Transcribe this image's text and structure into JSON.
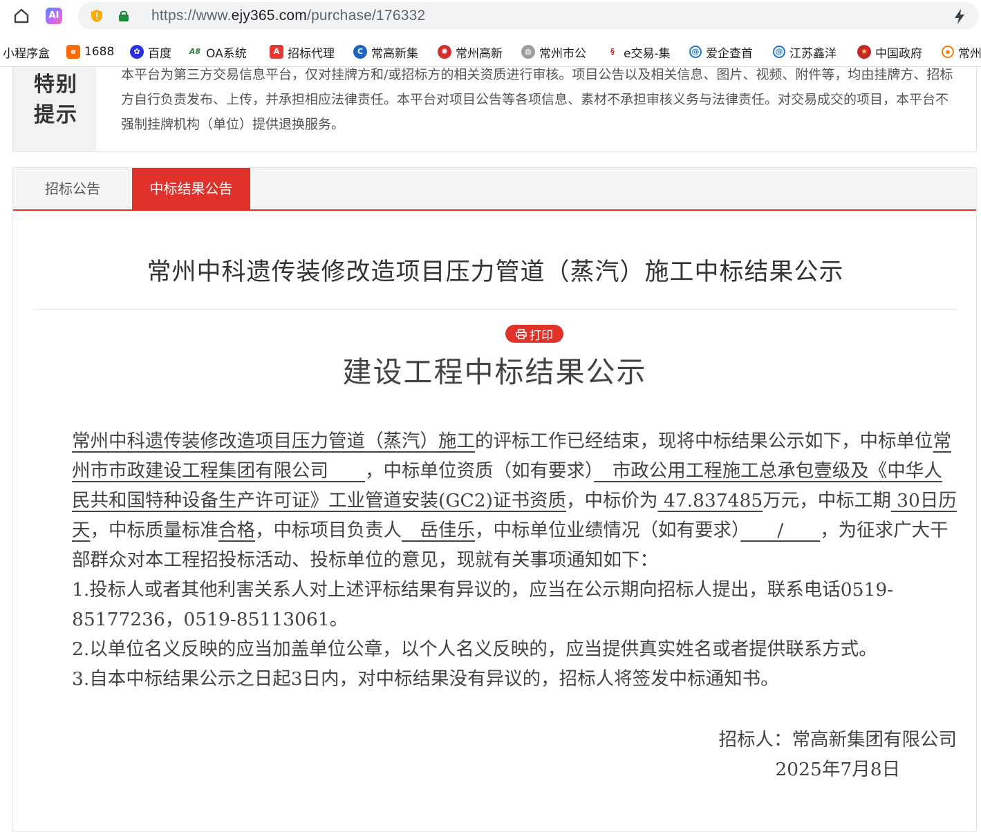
{
  "browser": {
    "url_prefix": "https://www.",
    "url_domain": "ejy365.com",
    "url_path": "/purchase/176332",
    "ai_label": "AI"
  },
  "bookmarks": [
    {
      "label": "小程序盒",
      "icon": "none",
      "color": ""
    },
    {
      "label": "1688",
      "icon": "1688-logo-icon",
      "color": "#ff6a00"
    },
    {
      "label": "百度",
      "icon": "baidu-paw-icon",
      "color": "#2932e1"
    },
    {
      "label": "OA系统",
      "icon": "oa-logo-icon",
      "color": "#2e7d32"
    },
    {
      "label": "招标代理",
      "icon": "pdf-icon",
      "color": "#e53935"
    },
    {
      "label": "常高新集",
      "icon": "cgx-logo-icon",
      "color": "#1e63c6"
    },
    {
      "label": "常州高新",
      "icon": "emblem-icon",
      "color": "#d32f2f"
    },
    {
      "label": "常州市公",
      "icon": "globe-icon",
      "color": "#9e9e9e"
    },
    {
      "label": "e交易-集",
      "icon": "ejy-logo-icon",
      "color": "#c62828"
    },
    {
      "label": "爱企查首",
      "icon": "aiqicha-icon",
      "color": "#1976d2"
    },
    {
      "label": "江苏鑫洋",
      "icon": "aiqicha-icon",
      "color": "#1976d2"
    },
    {
      "label": "中国政府",
      "icon": "national-emblem-icon",
      "color": "#c62828"
    },
    {
      "label": "常州",
      "icon": "swirl-icon",
      "color": "#f57c00"
    }
  ],
  "notice": {
    "label_line1": "特别",
    "label_line2": "提示",
    "text": "本平台为第三方交易信息平台，仅对挂牌方和/或招标方的相关资质进行审核。项目公告以及相关信息、图片、视频、附件等，均由挂牌方、招标方自行负责发布、上传，并承担相应法律责任。本平台对项目公告等各项信息、素材不承担审核义务与法律责任。对交易成交的项目，本平台不强制挂牌机构（单位）提供退换服务。"
  },
  "tabs": [
    {
      "label": "招标公告",
      "active": false
    },
    {
      "label": "中标结果公告",
      "active": true
    }
  ],
  "page_title": "常州中科遗传装修改造项目压力管道（蒸汽）施工中标结果公示",
  "print_label": "打印",
  "doc": {
    "title": "建设工程中标结果公示",
    "project_name": "常州中科遗传装修改造项目压力管道（蒸汽）施工",
    "t1": "的评标工作已经结束，现将中标结果公示如下，中标单位",
    "winner": "常州市市政建设工程集团有限公司　　",
    "t2": "，中标单位资质（如有要求）",
    "qualification": "　市政公用工程施工总承包壹级及《中华人民共和国特种设备生产许可证》工业管道安装(GC2)证书资质",
    "t3": "，中标价为",
    "price": " 47.837485",
    "t4": "万元，中标工期",
    "period": " 30日历天",
    "t5": "，中标质量标准",
    "quality": "合格",
    "t6": "，中标项目负责人",
    "manager": "　岳佳乐",
    "t7": "，中标单位业绩情况（如有要求）",
    "performance": "　　/　　",
    "t8": "，为征求广大干部群众对本工程招投标活动、投标单位的意见，现就有关事项通知如下：",
    "item1": "1.投标人或者其他利害关系人对上述评标结果有异议的，应当在公示期向招标人提出，联系电话0519-85177236，0519-85113061。",
    "item2": "2.以单位名义反映的应当加盖单位公章，以个人名义反映的，应当提供真实姓名或者提供联系方式。",
    "item3": "3.自本中标结果公示之日起3日内，对中标结果没有异议的，招标人将签发中标通知书。",
    "signer": "招标人：常高新集团有限公司",
    "date": "2025年7月8日"
  }
}
